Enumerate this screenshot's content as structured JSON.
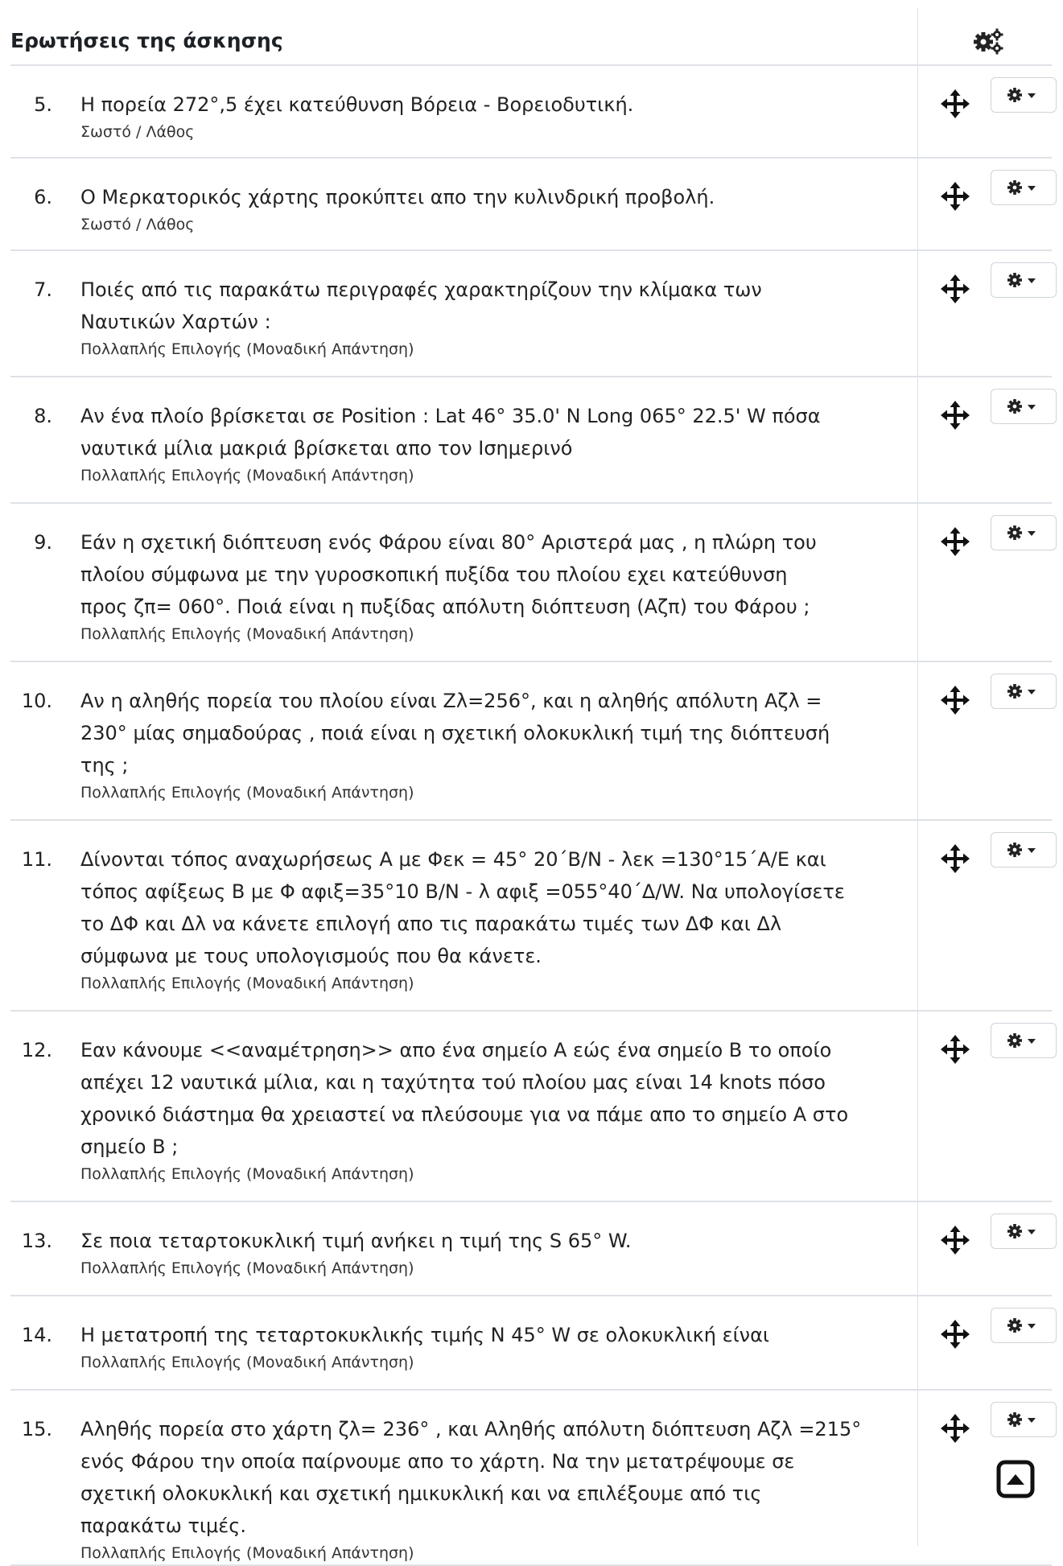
{
  "header": {
    "title": "Ερωτήσεις της άσκησης",
    "settings_icon": "gears-icon"
  },
  "questions": [
    {
      "number": "5.",
      "lines": [
        "Η πορεία 272°,5 έχει κατεύθυνση Βόρεια - Βορειοδυτική."
      ],
      "type": "Σωστό / Λάθος"
    },
    {
      "number": "6.",
      "lines": [
        "Ο Μερκατορικός χάρτης προκύπτει απο την κυλινδρική προβολή."
      ],
      "type": "Σωστό / Λάθος"
    },
    {
      "number": "7.",
      "lines": [
        "Ποιές από τις παρακάτω περιγραφές χαρακτηρίζουν την κλίμακα των",
        "Ναυτικών Χαρτών :"
      ],
      "type": "Πολλαπλής Επιλογής (Μοναδική Απάντηση)"
    },
    {
      "number": "8.",
      "lines": [
        "Αν ένα πλοίο βρίσκεται σε Position : Lat 46° 35.0' N Long 065° 22.5' W πόσα",
        "ναυτικά μίλια μακριά βρίσκεται απο τον Ισημερινό"
      ],
      "type": "Πολλαπλής Επιλογής (Μοναδική Απάντηση)"
    },
    {
      "number": "9.",
      "lines": [
        "Εάν η σχετική διόπτευση ενός Φάρου είναι 80° Αριστερά μας , η πλώρη του",
        "πλοίου σύμφωνα με την γυροσκοπική πυξίδα του πλοίου εχει κατεύθυνση",
        "προς ζπ= 060°. Ποιά είναι η πυξίδας απόλυτη διόπτευση (Αζπ) του Φάρου ;"
      ],
      "type": "Πολλαπλής Επιλογής (Μοναδική Απάντηση)"
    },
    {
      "number": "10.",
      "lines": [
        "Αν η αληθής πορεία του πλοίου είναι Ζλ=256°, και η αληθής απόλυτη Αζλ =",
        "230° μίας σημαδούρας , ποιά είναι η σχετική ολοκυκλική τιμή της διόπτευσή",
        "της ;"
      ],
      "type": "Πολλαπλής Επιλογής (Μοναδική Απάντηση)"
    },
    {
      "number": "11.",
      "lines": [
        "Δίνονται τόπος αναχωρήσεως Α με Φεκ = 45° 20΄Β/Ν - λεκ =130°15΄Α/Ε και",
        "τόπος αφίξεως Β με Φ αφιξ=35°10 Β/Ν - λ αφιξ =055°40΄Δ/W. Να υπολογίσετε",
        "το ΔΦ και Δλ να κάνετε επιλογή απο τις παρακάτω τιμές των ΔΦ και Δλ",
        "σύμφωνα με τους υπολογισμούς που θα κάνετε."
      ],
      "type": "Πολλαπλής Επιλογής (Μοναδική Απάντηση)"
    },
    {
      "number": "12.",
      "lines": [
        "Εαν κάνουμε <<αναμέτρηση>> απο ένα σημείο Α εώς ένα σημείο Β το οποίο",
        "απέχει 12 ναυτικά μίλια, και η ταχύτητα τού πλοίου μας είναι 14 knots πόσο",
        "χρονικό διάστημα θα χρειαστεί να πλεύσουμε για να πάμε απο το σημείο Α στο",
        "σημείο Β ;"
      ],
      "type": "Πολλαπλής Επιλογής (Μοναδική Απάντηση)"
    },
    {
      "number": "13.",
      "lines": [
        "Σε ποια τεταρτοκυκλική τιμή ανήκει η τιμή της S 65° W."
      ],
      "type": "Πολλαπλής Επιλογής (Μοναδική Απάντηση)"
    },
    {
      "number": "14.",
      "lines": [
        "Η μετατροπή της τεταρτοκυκλικής τιμής N 45° W σε ολοκυκλική είναι"
      ],
      "type": "Πολλαπλής Επιλογής (Μοναδική Απάντηση)"
    },
    {
      "number": "15.",
      "lines": [
        "Αληθής πορεία στο χάρτη ζλ= 236° , και Αληθής απόλυτη διόπτευση Αζλ =215°",
        "ενός Φάρου την οποία παίρνουμε απο το χάρτη. Να την μετατρέψουμε σε",
        "σχετική ολοκυκλική και σχετική ημικυκλική και να επιλέξουμε από τις",
        "παρακάτω τιμές."
      ],
      "type": "Πολλαπλής Επιλογής (Μοναδική Απάντηση)"
    }
  ],
  "row_icons": {
    "move": "move-arrows-icon",
    "settings": "gear-dropdown-icon"
  },
  "back_to_top_icon": "caret-up-square-icon"
}
